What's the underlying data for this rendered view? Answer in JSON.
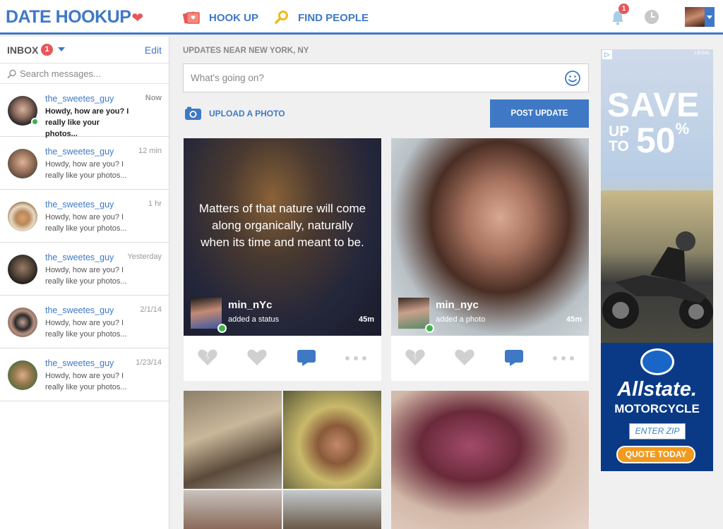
{
  "header": {
    "logo_text": "DATE HOOKUP",
    "nav": [
      {
        "label": "HOOK UP",
        "icon": "photos-icon"
      },
      {
        "label": "FIND PEOPLE",
        "icon": "search-icon"
      }
    ],
    "notification_count": "1",
    "colors": {
      "brand": "#3f79c6",
      "accent": "#e8565a"
    }
  },
  "sidebar": {
    "inbox_label": "INBOX",
    "inbox_count": "1",
    "edit_label": "Edit",
    "search_placeholder": "Search messages...",
    "messages": [
      {
        "name": "the_sweetes_guy",
        "time": "Now",
        "text": "Howdy, how are you? I really like your photos..."
      },
      {
        "name": "the_sweetes_guy",
        "time": "12 min",
        "text": "Howdy, how are you? I really like your photos..."
      },
      {
        "name": "the_sweetes_guy",
        "time": "1 hr",
        "text": "Howdy, how are you? I really like your photos..."
      },
      {
        "name": "the_sweetes_guy",
        "time": "Yesterday",
        "text": "Howdy, how are you? I really like your photos..."
      },
      {
        "name": "the_sweetes_guy",
        "time": "2/1/14",
        "text": "Howdy, how are you? I really like your photos..."
      },
      {
        "name": "the_sweetes_guy",
        "time": "1/23/14",
        "text": "Howdy, how are you? I really like your photos..."
      }
    ]
  },
  "feed": {
    "updates_label": "UPDATES NEAR NEW YORK, NY",
    "status_placeholder": "What's going on?",
    "upload_label": "UPLOAD A PHOTO",
    "post_button": "POST UPDATE",
    "posts": [
      {
        "quote": "Matters of that nature will come along organically, naturally when its time and meant to be.",
        "user": "min_nYc",
        "action": "added a status",
        "age": "45m"
      },
      {
        "quote": "",
        "user": "min_nyc",
        "action": "added a photo",
        "age": "45m"
      }
    ]
  },
  "ad": {
    "legal": "LEGAL",
    "save": "SAVE",
    "up_to": "UP TO",
    "percent": "50",
    "percent_sign": "%",
    "brand": "Allstate.",
    "product": "MOTORCYCLE",
    "zip_label": "ENTER ZIP",
    "cta": "QUOTE TODAY"
  }
}
